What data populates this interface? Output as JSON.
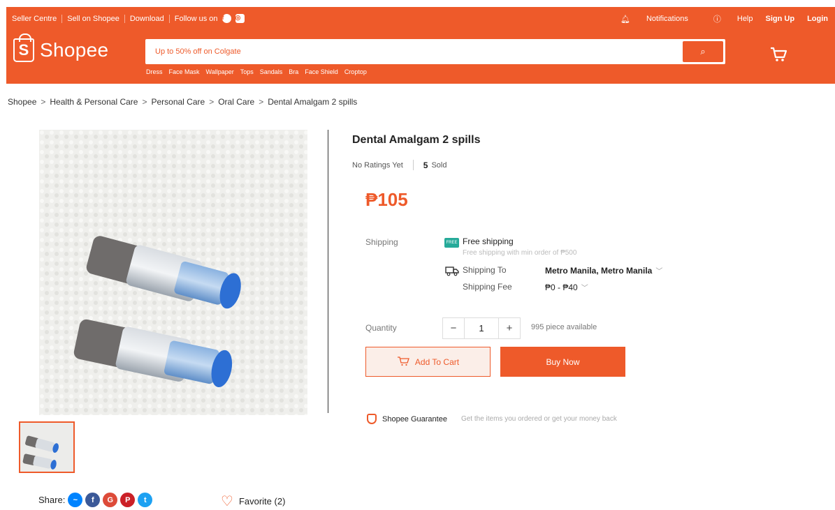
{
  "topbar": {
    "links": [
      "Seller Centre",
      "Sell on Shopee",
      "Download",
      "Follow us on"
    ],
    "notifications": "Notifications",
    "help": "Help",
    "signup": "Sign Up",
    "login": "Login"
  },
  "logo": {
    "text": "Shopee",
    "bag_letter": "S"
  },
  "search": {
    "placeholder": "Up to 50% off on Colgate",
    "keywords": [
      "Dress",
      "Face Mask",
      "Wallpaper",
      "Tops",
      "Sandals",
      "Bra",
      "Face Shield",
      "Croptop"
    ]
  },
  "breadcrumb": [
    "Shopee",
    "Health & Personal Care",
    "Personal Care",
    "Oral Care",
    "Dental Amalgam 2 spills"
  ],
  "product": {
    "title": "Dental Amalgam 2 spills",
    "rating": "No Ratings Yet",
    "sold_count": "5",
    "sold_label": "Sold",
    "price": "₱105",
    "shipping_label": "Shipping",
    "free_shipping": "Free shipping",
    "free_shipping_sub": "Free shipping with min order of ₱500",
    "ship_to_label": "Shipping To",
    "ship_to_value": "Metro Manila, Metro Manila",
    "fee_label": "Shipping Fee",
    "fee_value": "₱0 - ₱40",
    "quantity_label": "Quantity",
    "quantity": "1",
    "available": "995 piece available",
    "add_to_cart": "Add To Cart",
    "buy_now": "Buy Now",
    "guarantee": "Shopee Guarantee",
    "guarantee_text": "Get the items you ordered or get your money back"
  },
  "share": {
    "label": "Share:"
  },
  "favorite": {
    "label": "Favorite (2)"
  },
  "colors": {
    "brand": "#ee5a2a",
    "messenger": "#0084ff",
    "facebook": "#3b5998",
    "google": "#dd4b39",
    "pinterest": "#cb2027",
    "twitter": "#1da1f2"
  }
}
